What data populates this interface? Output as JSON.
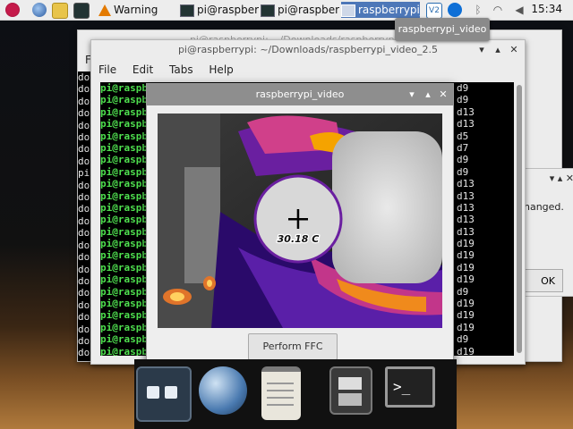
{
  "taskbar": {
    "warning_label": "Warning",
    "tasks": [
      "pi@raspberr...",
      "pi@raspberr...",
      "raspberrypi_..."
    ],
    "clock": "15:34",
    "icons": [
      "raspberry-menu-icon",
      "web-browser-icon",
      "file-manager-icon",
      "terminal-icon",
      "warning-icon",
      "vnc-icon",
      "teamviewer-icon",
      "bluetooth-icon",
      "wifi-icon",
      "volume-icon"
    ]
  },
  "tooltip": "raspberrypi_video",
  "back_terminal": {
    "title": "pi@raspberrypi: ~/Downloads/raspberrypi_video_2...",
    "menu_first": "F",
    "rows": [
      "do",
      "do",
      "do",
      "do",
      "do",
      "do",
      "do",
      "do",
      "pi",
      "do",
      "do",
      "do",
      "do",
      "do",
      "do",
      "do",
      "do",
      "do",
      "do",
      "do",
      "do",
      "do",
      "do",
      "do",
      "do"
    ]
  },
  "front_terminal": {
    "title": "pi@raspberrypi: ~/Downloads/raspberrypi_video_2.5",
    "menu": [
      "File",
      "Edit",
      "Tabs",
      "Help"
    ],
    "prompt": "pi@raspbe",
    "right_col": [
      "d9",
      "d9",
      "d13",
      "d13",
      "d5",
      "d7",
      "d9",
      "d9",
      "d13",
      "d13",
      "d13",
      "d13",
      "d13",
      "d19",
      "d19",
      "d19",
      "d19",
      "d9",
      "d19",
      "d19",
      "d19",
      "d9",
      "d19"
    ]
  },
  "dialog": {
    "text": "hanged.",
    "button": "OK"
  },
  "video": {
    "title": "raspberrypi_video",
    "temperature": "30.18 C",
    "ffc_button": "Perform FFC"
  },
  "colors": {
    "accent": "#4d77b8",
    "prompt": "#4fe04f",
    "hot": "#f5a300",
    "warm": "#7b2fb8"
  }
}
